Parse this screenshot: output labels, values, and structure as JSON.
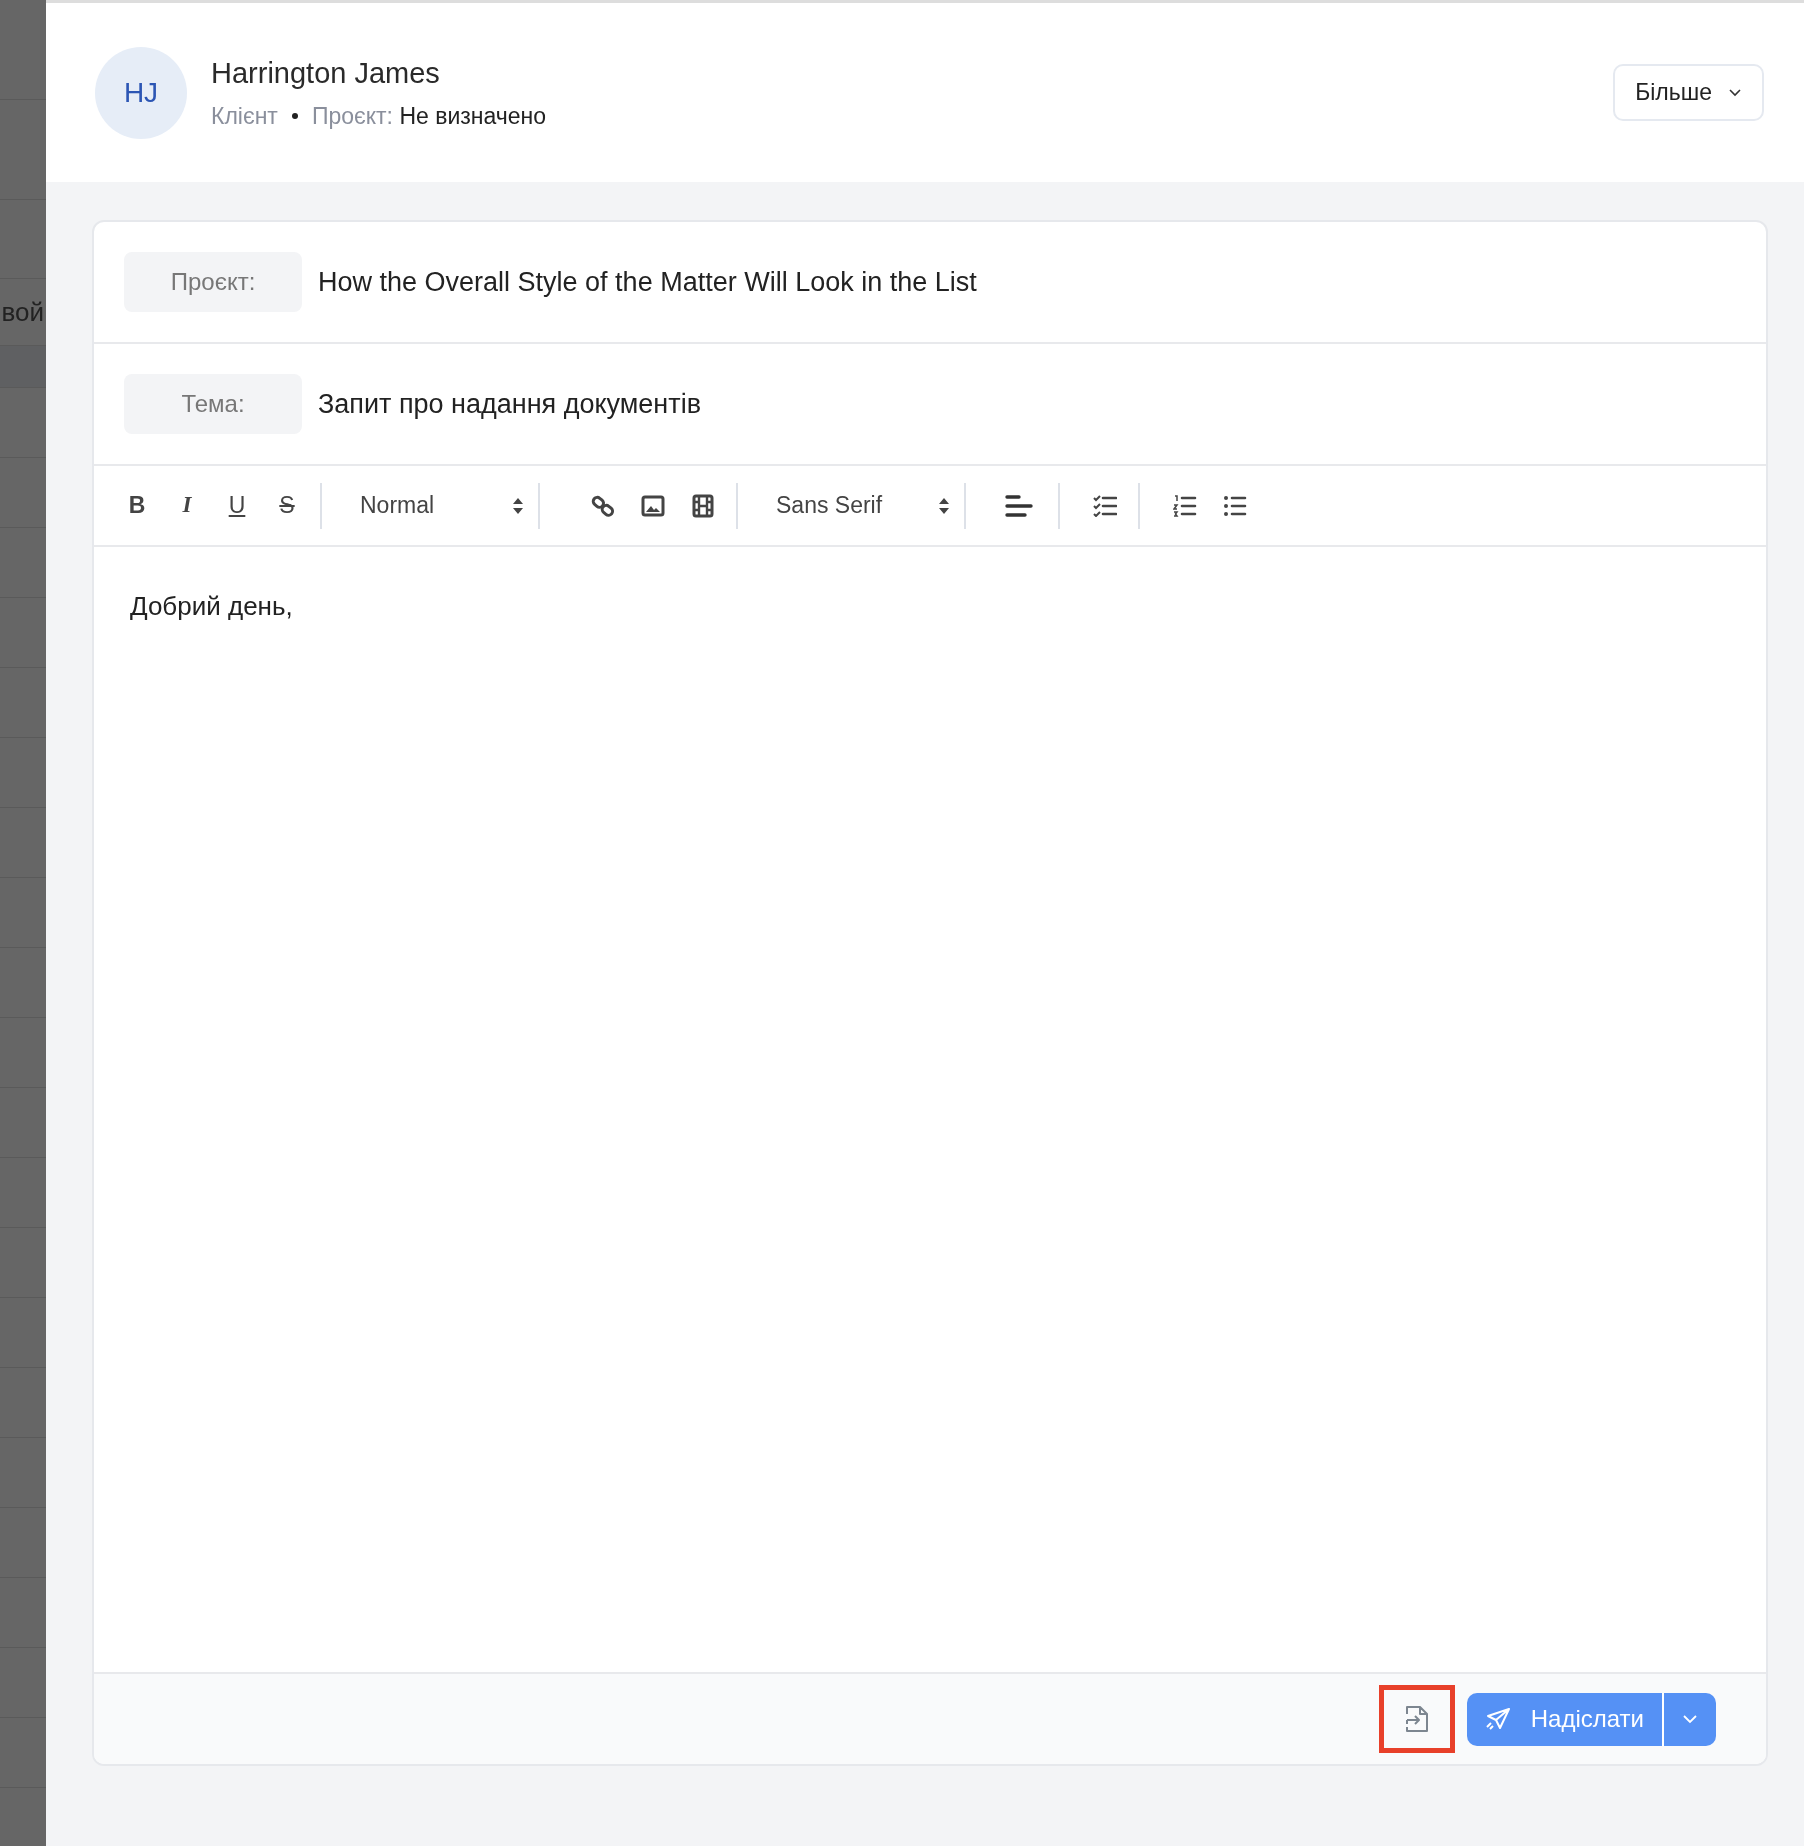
{
  "background_fragment": {
    "text": "вой"
  },
  "header": {
    "avatar_initials": "HJ",
    "name": "Harrington James",
    "role": "Клієнт",
    "project_label": "Проєкт:",
    "project_value": "Не визначено",
    "more_button": "Більше"
  },
  "fields": [
    {
      "label": "Проєкт:",
      "value": "How the Overall Style of the Matter Will Look in the List"
    },
    {
      "label": "Тема:",
      "value": "Запит про надання документів"
    }
  ],
  "toolbar": {
    "format_buttons": [
      {
        "kind": "bold",
        "text": "B"
      },
      {
        "kind": "italic",
        "text": "I"
      },
      {
        "kind": "underline",
        "text": "U"
      },
      {
        "kind": "strike",
        "text": "S"
      }
    ],
    "heading_select": "Normal",
    "font_select": "Sans Serif"
  },
  "editor": {
    "text": "Добрий день,"
  },
  "footer": {
    "attach_highlighted": true,
    "send_button": "Надіслати"
  }
}
